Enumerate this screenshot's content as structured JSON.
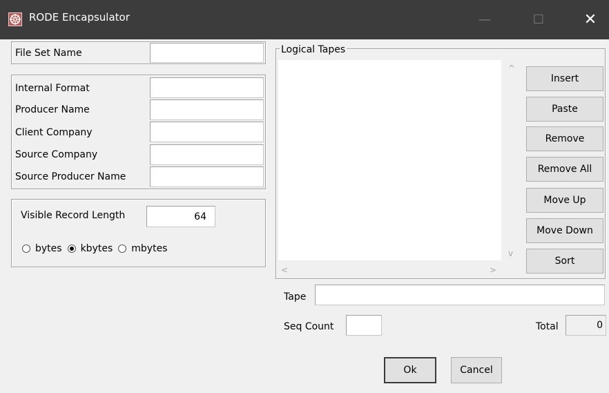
{
  "window": {
    "title": "RODE Encapsulator",
    "minimize_glyph": "—",
    "maximize_glyph": "☐",
    "close_glyph": "✕"
  },
  "fileset": {
    "label": "File Set Name",
    "value": ""
  },
  "info_fields": [
    {
      "label": "Internal Format",
      "value": ""
    },
    {
      "label": "Producer Name",
      "value": ""
    },
    {
      "label": "Client Company",
      "value": ""
    },
    {
      "label": "Source Company",
      "value": ""
    },
    {
      "label": "Source Producer Name",
      "value": ""
    }
  ],
  "record": {
    "label": "Visible Record Length",
    "value": "64",
    "units": [
      {
        "label": "bytes",
        "selected": false
      },
      {
        "label": "kbytes",
        "selected": true
      },
      {
        "label": "mbytes",
        "selected": false
      }
    ]
  },
  "logical_tapes": {
    "legend": "Logical Tapes",
    "items": [],
    "scroll_up": "^",
    "scroll_down": "v",
    "scroll_left": "<",
    "scroll_right": ">"
  },
  "list_buttons": {
    "insert": "Insert",
    "paste": "Paste",
    "remove": "Remove",
    "remove_all": "Remove All",
    "move_up": "Move Up",
    "move_down": "Move Down",
    "sort": "Sort"
  },
  "tape": {
    "label": "Tape",
    "value": ""
  },
  "seq_count": {
    "label": "Seq Count",
    "value": ""
  },
  "total": {
    "label": "Total",
    "value": "0"
  },
  "dialog_buttons": {
    "ok": "Ok",
    "cancel": "Cancel"
  }
}
